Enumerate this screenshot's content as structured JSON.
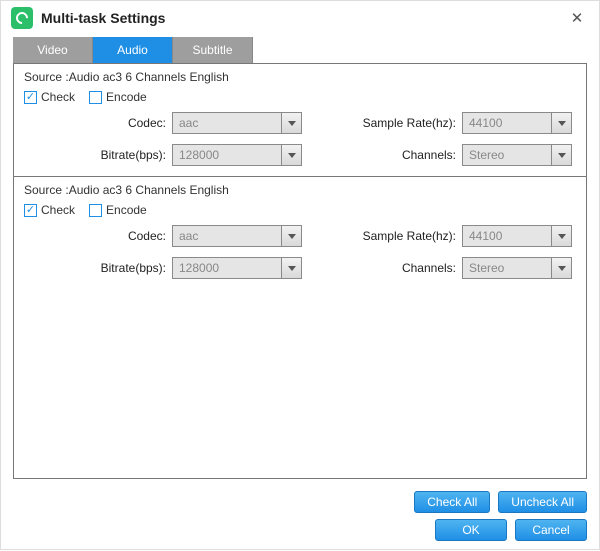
{
  "title": "Multi-task Settings",
  "tabs": {
    "video": "Video",
    "audio": "Audio",
    "subtitle": "Subtitle"
  },
  "active_tab": "audio",
  "labels": {
    "check": "Check",
    "encode": "Encode",
    "codec": "Codec:",
    "sample_rate": "Sample Rate(hz):",
    "bitrate": "Bitrate(bps):",
    "channels": "Channels:"
  },
  "sources": [
    {
      "header": "Source :Audio  ac3  6 Channels  English",
      "check": true,
      "encode": false,
      "codec": "aac",
      "sample_rate": "44100",
      "bitrate": "128000",
      "channels": "Stereo"
    },
    {
      "header": "Source :Audio  ac3  6 Channels  English",
      "check": true,
      "encode": false,
      "codec": "aac",
      "sample_rate": "44100",
      "bitrate": "128000",
      "channels": "Stereo"
    }
  ],
  "buttons": {
    "check_all": "Check All",
    "uncheck_all": "Uncheck All",
    "ok": "OK",
    "cancel": "Cancel"
  }
}
